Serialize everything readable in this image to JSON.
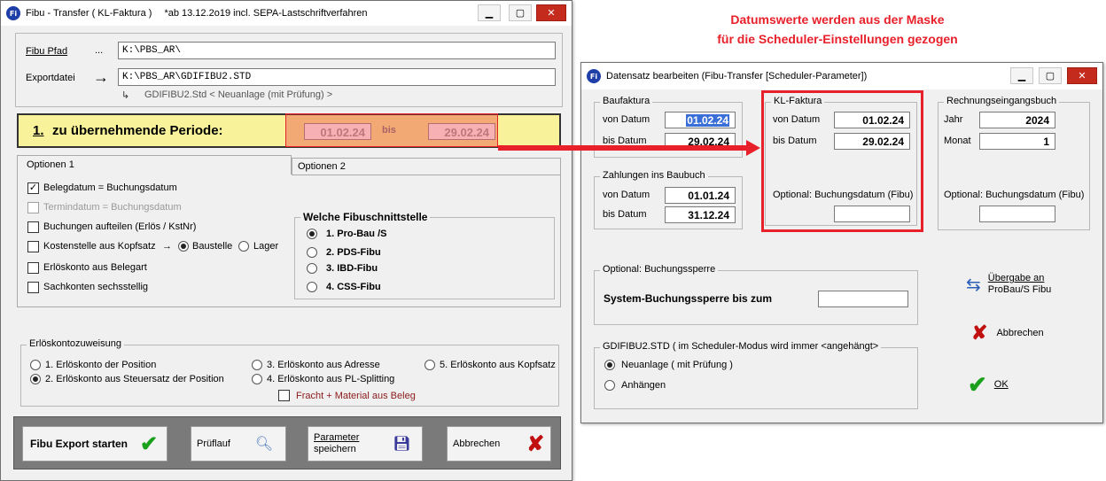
{
  "left": {
    "title": "Fibu - Transfer ( KL-Faktura )",
    "title_note": "*ab 13.12.2o19 incl. SEPA-Lastschriftverfahren",
    "fibu_pfad_label": "Fibu Pfad",
    "fibu_pfad_dots": "...",
    "fibu_pfad_value": "K:\\PBS_AR\\",
    "exportdatei_label": "Exportdatei",
    "exportdatei_value": "K:\\PBS_AR\\GDIFIBU2.STD",
    "neuanlage_hint": "GDIFIBU2.Std < Neuanlage (mit Prüfung) >",
    "period": {
      "number": "1.",
      "label": "zu übernehmende Periode:",
      "from": "01.02.24",
      "bis": "bis",
      "to": "29.02.24"
    },
    "tabs": [
      "Optionen 1",
      "Optionen 2"
    ],
    "options": {
      "belegdatum": "Belegdatum   = Buchungsdatum",
      "termindatum": "Termindatum = Buchungsdatum",
      "buchungen": "Buchungen aufteilen (Erlös / KstNr)",
      "kostenstelle": "Kostenstelle aus Kopfsatz",
      "baustelle": "Baustelle",
      "lager": "Lager",
      "erloeskonto_beleg": "Erlöskonto aus Belegart",
      "sachkonten": "Sachkonten sechsstellig"
    },
    "schnittstelle": {
      "title": "Welche Fibuschnittstelle",
      "items": [
        "1.  Pro-Bau /S",
        "2.  PDS-Fibu",
        "3.  IBD-Fibu",
        "4.  CSS-Fibu"
      ]
    },
    "erloes": {
      "title": "Erlöskontozuweisung",
      "o1": "1.  Erlöskonto der Position",
      "o2": "2.  Erlöskonto aus Steuersatz der Position",
      "o3": "3.  Erlöskonto aus Adresse",
      "o4": "4.  Erlöskonto aus PL-Splitting",
      "o5": "5.  Erlöskonto aus Kopfsatz",
      "fracht": "Fracht + Material aus Beleg"
    },
    "buttons": {
      "export": "Fibu Export starten",
      "pruef": "Prüflauf",
      "param1": "Parameter",
      "param2": "speichern",
      "abbrechen": "Abbrechen"
    }
  },
  "annotation": {
    "line1": "Datumswerte werden aus der Maske",
    "line2": "für die Scheduler-Einstellungen gezogen",
    "color": "#e8202a"
  },
  "right": {
    "title": "Datensatz bearbeiten  (Fibu-Transfer [Scheduler-Parameter])",
    "baufaktura": {
      "title": "Baufaktura",
      "von_label": "von Datum",
      "von": "01.02.24",
      "bis_label": "bis Datum",
      "bis": "29.02.24"
    },
    "zahlungen": {
      "title": "Zahlungen ins Baubuch",
      "von_label": "von Datum",
      "von": "01.01.24",
      "bis_label": "bis Datum",
      "bis": "31.12.24"
    },
    "klfaktura": {
      "title": "KL-Faktura",
      "von_label": "von Datum",
      "von": "01.02.24",
      "bis_label": "bis Datum",
      "bis": "29.02.24",
      "optional": "Optional: Buchungsdatum (Fibu)"
    },
    "rechnung": {
      "title": "Rechnungseingangsbuch",
      "jahr_label": "Jahr",
      "jahr": "2024",
      "monat_label": "Monat",
      "monat": "1",
      "optional": "Optional: Buchungsdatum (Fibu)"
    },
    "sperre": {
      "title": "Optional: Buchungssperre",
      "label": "System-Buchungssperre bis zum"
    },
    "gdi": {
      "title": "GDIFIBU2.STD  ( im Scheduler-Modus wird immer <angehängt>",
      "neu": "Neuanlage ( mit Prüfung )",
      "anh": "Anhängen"
    },
    "uebergabe1": "Übergabe an",
    "uebergabe2": "ProBau/S Fibu",
    "abbrechen": "Abbrechen",
    "ok": "OK"
  }
}
